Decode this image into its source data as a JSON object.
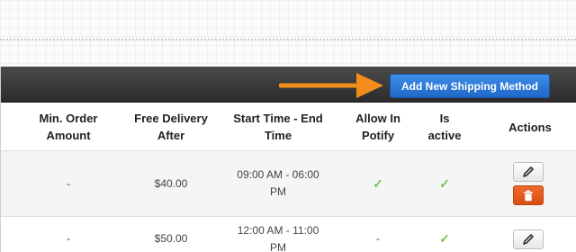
{
  "toolbar": {
    "add_button_label": "Add New Shipping Method"
  },
  "table": {
    "columns": [
      "Min. Order Amount",
      "Free Delivery After",
      "Start Time - End Time",
      "Allow In Potify",
      "Is active",
      "Actions"
    ],
    "column_lines": [
      [
        "Min. Order",
        "Amount"
      ],
      [
        "Free Delivery",
        "After"
      ],
      [
        "Start Time - End",
        "Time"
      ],
      [
        "Allow In",
        "Potify"
      ],
      [
        "Is",
        "active"
      ],
      [
        "Actions"
      ]
    ],
    "rows": [
      {
        "min_order": "-",
        "free_delivery_after": "$40.00",
        "time_line1": "09:00 AM - 06:00",
        "time_line2": "PM",
        "allow_in_potify": "✓",
        "is_active": "✓"
      },
      {
        "min_order": "-",
        "free_delivery_after": "$50.00",
        "time_line1": "12:00 AM - 11:00",
        "time_line2": "PM",
        "allow_in_potify": "-",
        "is_active": "✓"
      }
    ]
  },
  "colors": {
    "toolbar": "#333333",
    "add_button": "#2a7ad9",
    "arrow": "#f28c1a",
    "check": "#7cc24a",
    "delete_button": "#e05a1c"
  },
  "icons": {
    "edit": "pencil-icon",
    "delete": "trash-icon",
    "annotation": "arrow-right-icon"
  }
}
